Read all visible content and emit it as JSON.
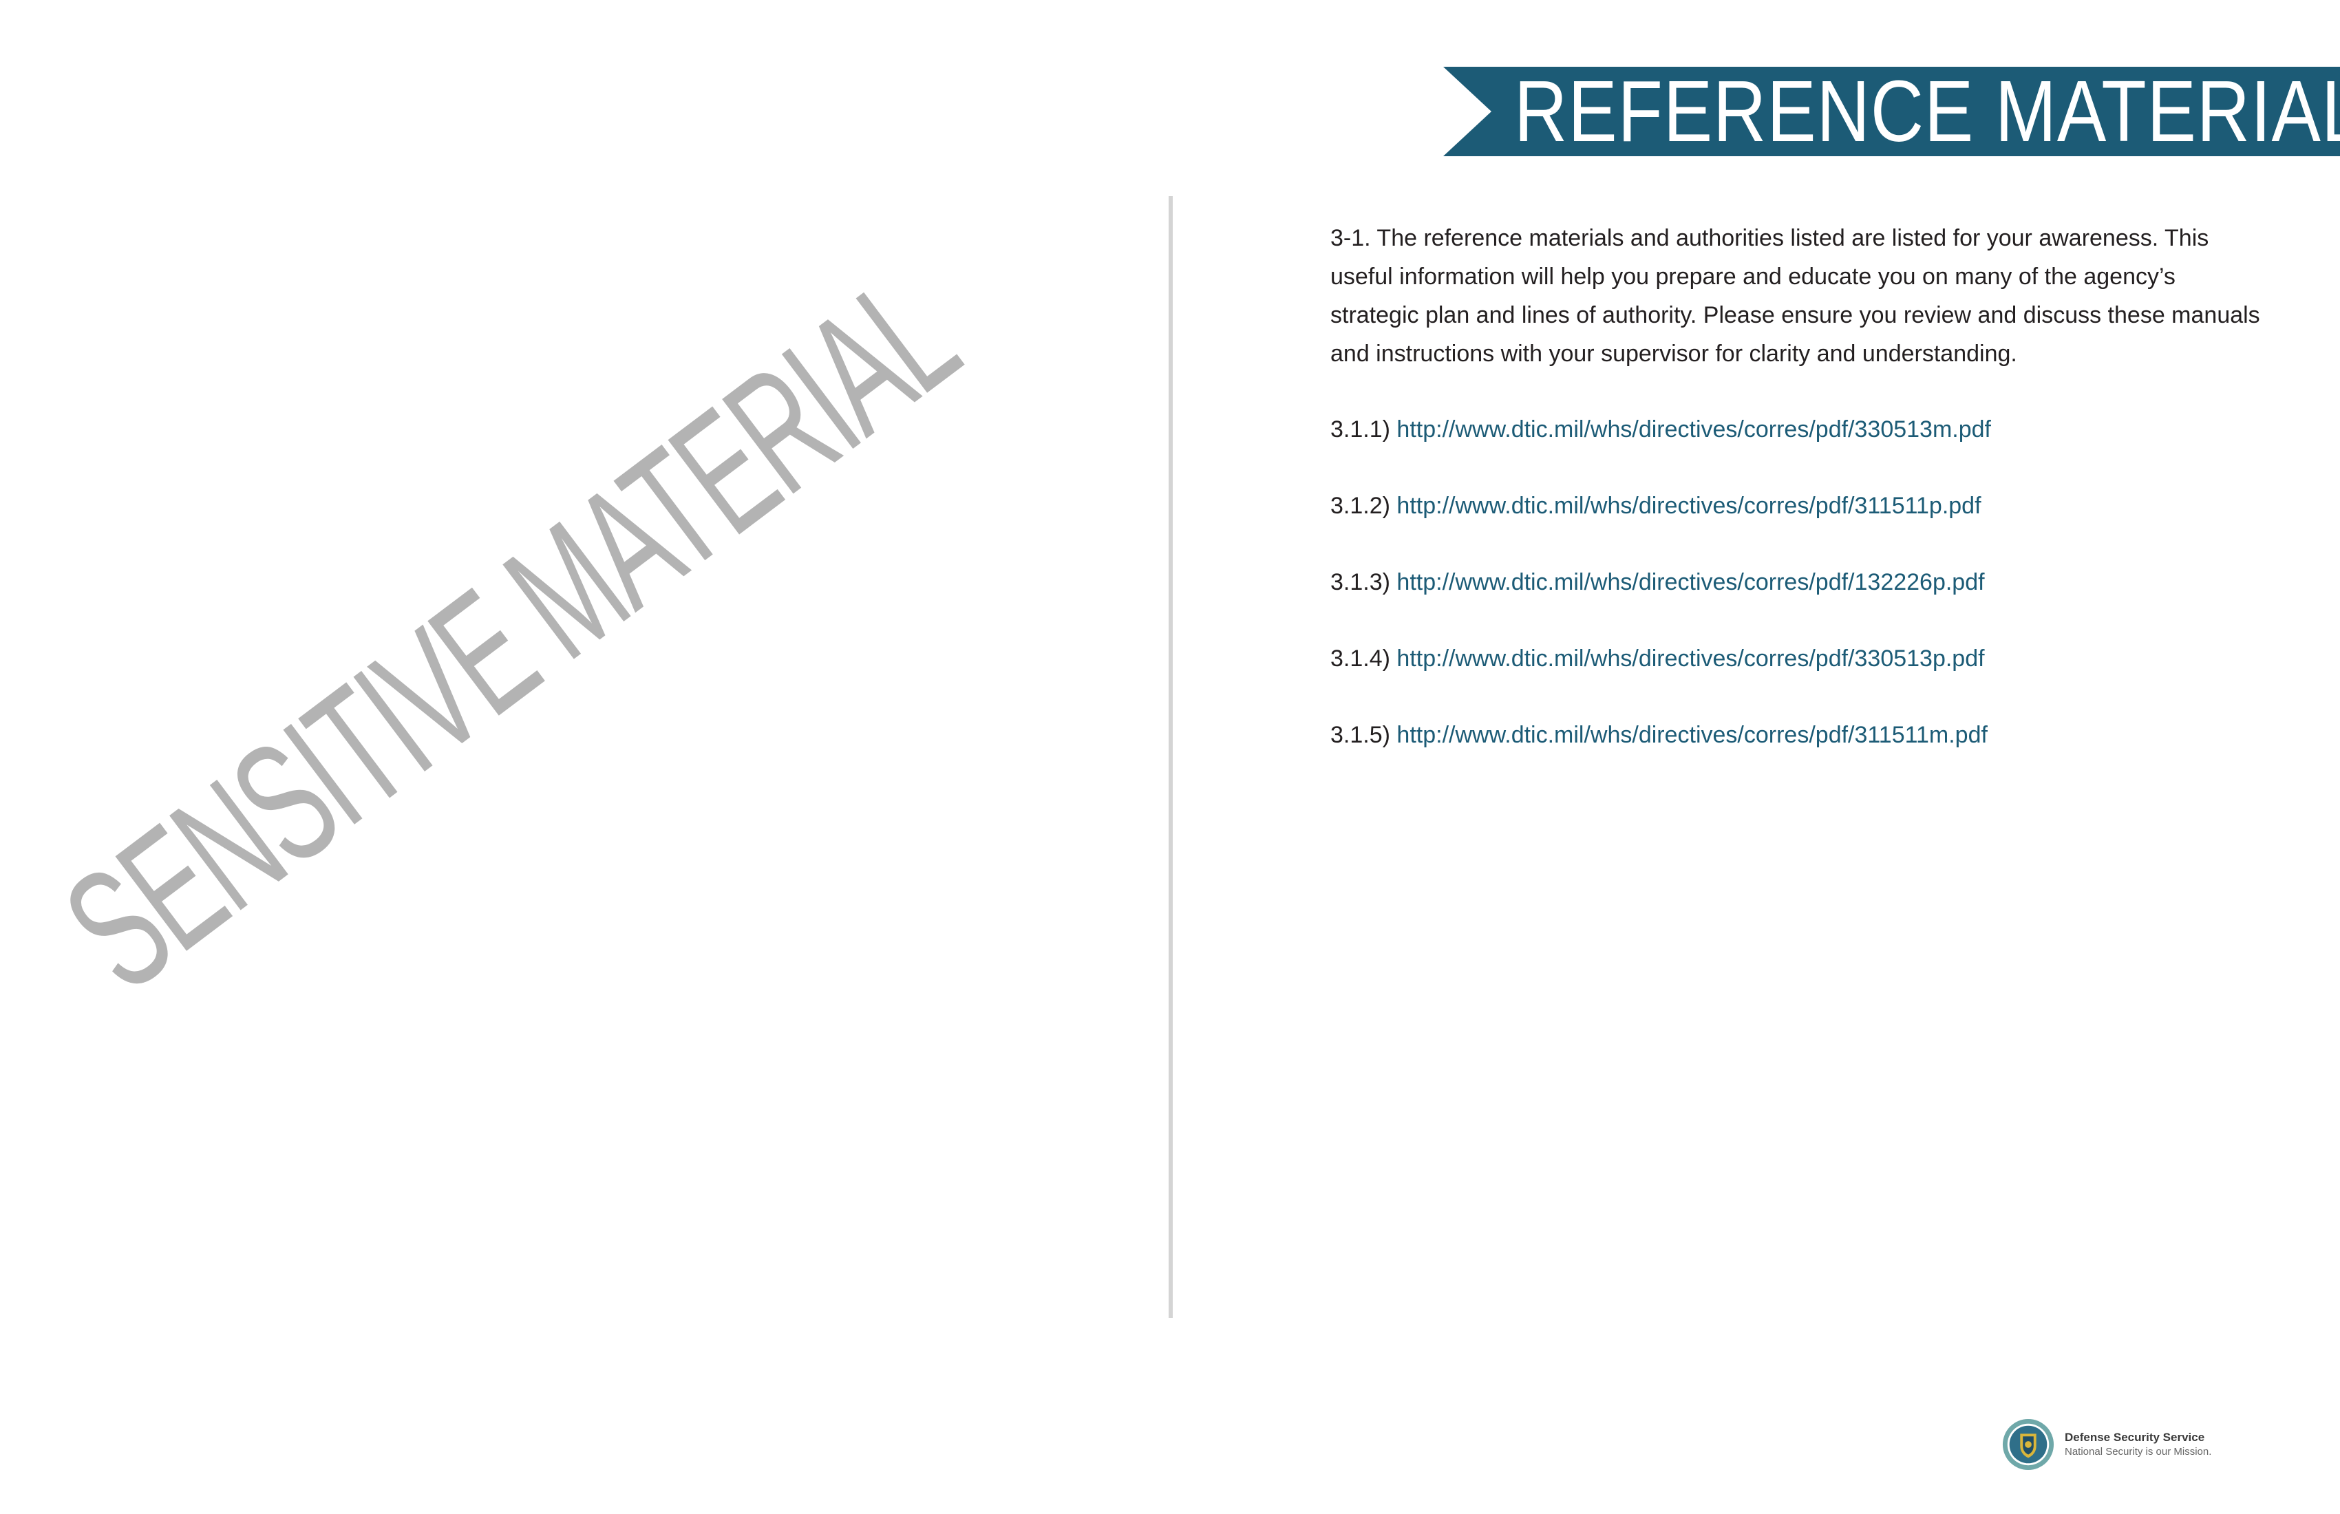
{
  "watermark": {
    "text": "SENSITIVE MATERIAL"
  },
  "header": {
    "title": "REFERENCE MATERIALS"
  },
  "body": {
    "intro": "3-1. The reference materials and authorities listed are listed for your awareness. This useful information will help you prepare and educate you on many of the agency’s strategic plan and lines of authority. Please ensure you review and discuss these manuals and instructions with your supervisor for clarity and understanding.",
    "references": [
      {
        "number": "3.1.1)",
        "url": "http://www.dtic.mil/whs/directives/corres/pdf/330513m.pdf"
      },
      {
        "number": "3.1.2)",
        "url": "http://www.dtic.mil/whs/directives/corres/pdf/311511p.pdf"
      },
      {
        "number": "3.1.3)",
        "url": "http://www.dtic.mil/whs/directives/corres/pdf/132226p.pdf"
      },
      {
        "number": "3.1.4)",
        "url": "http://www.dtic.mil/whs/directives/corres/pdf/330513p.pdf"
      },
      {
        "number": "3.1.5)",
        "url": "http://www.dtic.mil/whs/directives/corres/pdf/311511m.pdf"
      }
    ]
  },
  "footer": {
    "org_name": "Defense Security Service",
    "tagline": "National Security is our Mission.",
    "logo_icon": "dss-seal-icon"
  },
  "colors": {
    "banner": "#1c5b76",
    "link": "#1c5b76",
    "watermark": "#b3b3b3",
    "divider": "#d4d4d4"
  }
}
